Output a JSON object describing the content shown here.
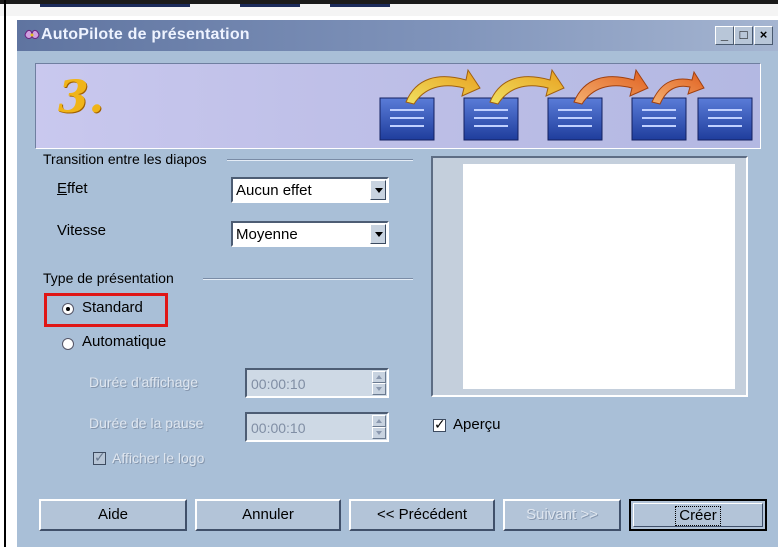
{
  "window": {
    "title": "AutoPilote de présentation"
  },
  "titlebar_buttons": {
    "minimize": "_",
    "maximize": "□",
    "close": "×"
  },
  "banner": {
    "step_number": "3."
  },
  "transition": {
    "group_label": "Transition entre les diapos",
    "effect_label": "Effet",
    "effect_value": "Aucun effet",
    "speed_label": "Vitesse",
    "speed_value": "Moyenne"
  },
  "presentation_type": {
    "group_label": "Type de présentation",
    "standard_label": "Standard",
    "automatic_label": "Automatique",
    "selected": "Standard",
    "display_duration_label": "Durée d'affichage",
    "display_duration_value": "00:00:10",
    "pause_duration_label": "Durée de la pause",
    "pause_duration_value": "00:00:10",
    "show_logo_label": "Afficher le logo",
    "show_logo_checked": true
  },
  "preview": {
    "checkbox_label": "Aperçu",
    "checked": true
  },
  "buttons": {
    "help": "Aide",
    "cancel": "Annuler",
    "previous": "<< Précédent",
    "next": "Suivant >>",
    "create": "Créer"
  },
  "colors": {
    "dialog_bg": "#a9bfd7",
    "highlight_box": "#e01616",
    "banner_step": "#f0b418"
  }
}
